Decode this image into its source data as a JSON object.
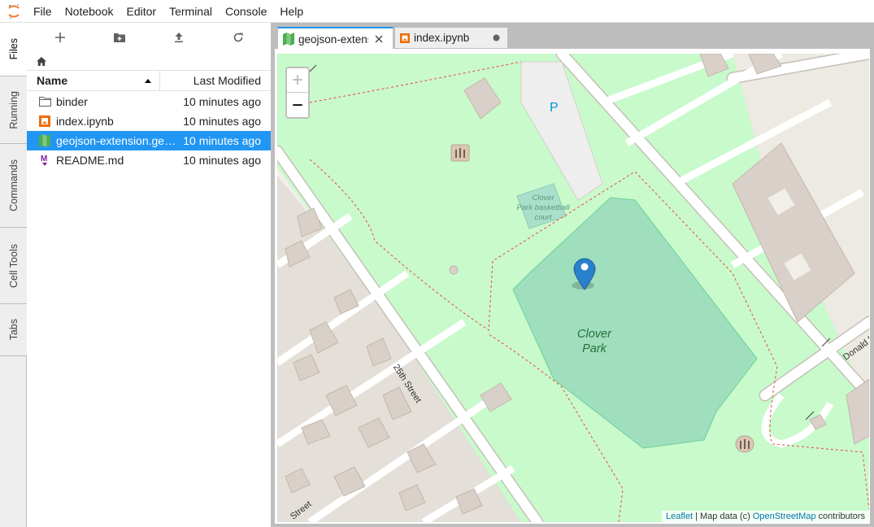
{
  "menu": [
    "File",
    "Notebook",
    "Editor",
    "Terminal",
    "Console",
    "Help"
  ],
  "sidebar_tabs": [
    "Files",
    "Running",
    "Commands",
    "Cell Tools",
    "Tabs"
  ],
  "file_browser": {
    "columns": {
      "name": "Name",
      "modified": "Last Modified"
    },
    "files": [
      {
        "name": "binder",
        "modified": "10 minutes ago",
        "icon": "folder-icon"
      },
      {
        "name": "index.ipynb",
        "modified": "10 minutes ago",
        "icon": "notebook-icon"
      },
      {
        "name": "geojson-extension.geojson",
        "modified": "10 minutes ago",
        "icon": "map-file-icon",
        "selected": true
      },
      {
        "name": "README.md",
        "modified": "10 minutes ago",
        "icon": "markdown-icon"
      }
    ]
  },
  "tabs": [
    {
      "label": "geojson-extension.geojson",
      "active": true
    },
    {
      "label": "index.ipynb",
      "active": false
    }
  ],
  "map": {
    "labels": {
      "parking": "P",
      "court_line1": "Clover",
      "court_line2": "Park basketball",
      "court_line3": "court",
      "park_line1": "Clover",
      "park_line2": "Park",
      "street_25th": "25th Street",
      "street_bottom": "Street",
      "street_donald": "Donald D"
    },
    "zoom": {
      "in": "+",
      "out": "−"
    },
    "attribution": {
      "leaflet": "Leaflet",
      "middle": " | Map data (c) ",
      "osm": "OpenStreetMap",
      "end": " contributors"
    }
  }
}
